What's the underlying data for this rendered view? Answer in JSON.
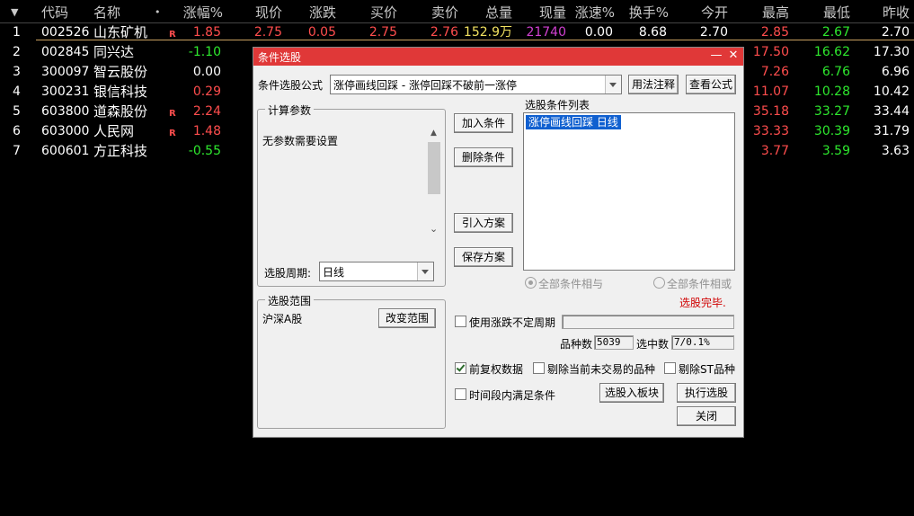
{
  "table": {
    "header": {
      "sort": "▼",
      "code": "代码",
      "name": "名称",
      "dot": "•",
      "change_pct": "涨幅%",
      "price": "现价",
      "change": "涨跌",
      "bid": "买价",
      "ask": "卖价",
      "volume": "总量",
      "cur_vol": "现量",
      "speed": "涨速%",
      "turnover": "换手%",
      "open": "今开",
      "high": "最高",
      "low": "最低",
      "prev": "昨收"
    },
    "rows": [
      {
        "idx": "1",
        "code": "002526",
        "name": "山东矿机",
        "mark": "R",
        "change_pct": "1.85",
        "price": "2.75",
        "change": "0.05",
        "bid": "2.75",
        "ask": "2.76",
        "volume": "152.9万",
        "cur_vol": "21740",
        "speed": "0.00",
        "turnover": "8.68",
        "open": "2.70",
        "high": "2.85",
        "low": "2.67",
        "prev": "2.70"
      },
      {
        "idx": "2",
        "code": "002845",
        "name": "同兴达",
        "mark": "",
        "change_pct": "-1.10",
        "high": "17.50",
        "low": "16.62",
        "prev": "17.30"
      },
      {
        "idx": "3",
        "code": "300097",
        "name": "智云股份",
        "mark": "",
        "change_pct": "0.00",
        "high": "7.26",
        "low": "6.76",
        "prev": "6.96"
      },
      {
        "idx": "4",
        "code": "300231",
        "name": "银信科技",
        "mark": "",
        "change_pct": "0.29",
        "high": "11.07",
        "low": "10.28",
        "prev": "10.42"
      },
      {
        "idx": "5",
        "code": "603800",
        "name": "道森股份",
        "mark": "R",
        "change_pct": "2.24",
        "high": "35.18",
        "low": "33.27",
        "prev": "33.44"
      },
      {
        "idx": "6",
        "code": "603000",
        "name": "人民网",
        "mark": "R",
        "change_pct": "1.48",
        "high": "33.33",
        "low": "30.39",
        "prev": "31.79"
      },
      {
        "idx": "7",
        "code": "600601",
        "name": "方正科技",
        "mark": "",
        "change_pct": "-0.55",
        "high": "3.77",
        "low": "3.59",
        "prev": "3.63"
      }
    ]
  },
  "colors": {
    "up": "#ff4d4d",
    "down": "#2ee82e",
    "title_bar": "#e03838",
    "selection": "#1060d0"
  },
  "dialog": {
    "title": "条件选股",
    "minimize": "—",
    "close": "✕",
    "formula_label": "条件选股公式",
    "formula_value": "涨停画线回踩 - 涨停回踩不破前一涨停",
    "usage_btn": "用法注释",
    "view_btn": "查看公式",
    "params_group": "计算参数",
    "params_text": "无参数需要设置",
    "period_label": "选股周期:",
    "period_value": "日线",
    "add_btn": "加入条件",
    "delete_btn": "删除条件",
    "import_btn": "引入方案",
    "save_btn": "保存方案",
    "list_label": "选股条件列表",
    "list_items": [
      "涨停画线回踩   日线"
    ],
    "radio_and": "全部条件相与",
    "radio_or": "全部条件相或",
    "status": "选股完毕.",
    "range_group": "选股范围",
    "range_value": "沪深A股",
    "change_range_btn": "改变范围",
    "use_period_label": "使用涨跌不定周期",
    "count_label": "品种数",
    "count_value": "5039",
    "selected_label": "选中数",
    "selected_value": "7/0.1%",
    "qfq_label": "前复权数据",
    "exclude_untraded_label": "剔除当前未交易的品种",
    "exclude_st_label": "剔除ST品种",
    "time_range_label": "时间段内满足条件",
    "to_block_btn": "选股入板块",
    "run_btn": "执行选股",
    "close_btn": "关闭"
  }
}
